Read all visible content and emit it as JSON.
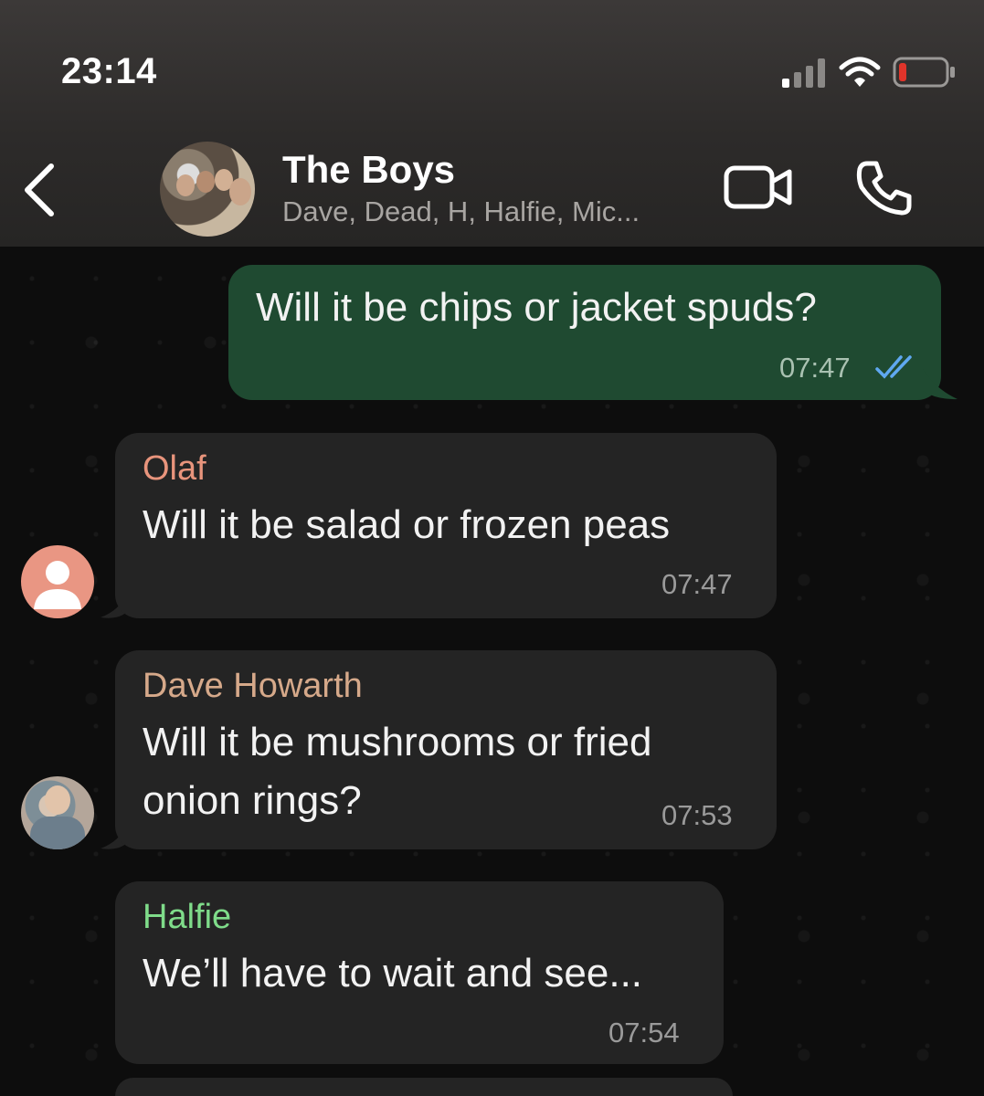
{
  "status_bar": {
    "time": "23:14"
  },
  "header": {
    "title": "The Boys",
    "subtitle": "Dave, Dead, H, Halfie, Mic..."
  },
  "messages": [
    {
      "direction": "outgoing",
      "text": "Will it be chips or jacket spuds?",
      "time": "07:47",
      "status": "read"
    },
    {
      "direction": "incoming",
      "sender": "Olaf",
      "sender_color": "#e8947c",
      "text": "Will it be salad or frozen peas",
      "time": "07:47"
    },
    {
      "direction": "incoming",
      "sender": "Dave Howarth",
      "sender_color": "#d6a98a",
      "text_line1": "Will it be mushrooms or fried",
      "text_line2": "onion rings?",
      "time": "07:53"
    },
    {
      "direction": "incoming",
      "sender": "Halfie",
      "sender_color": "#7fdc8a",
      "text": "We’ll have to wait and see...",
      "time": "07:54"
    }
  ],
  "colors": {
    "outgoing_bubble": "#1f4a31",
    "incoming_bubble": "#242424",
    "read_ticks": "#5fa8f0"
  }
}
